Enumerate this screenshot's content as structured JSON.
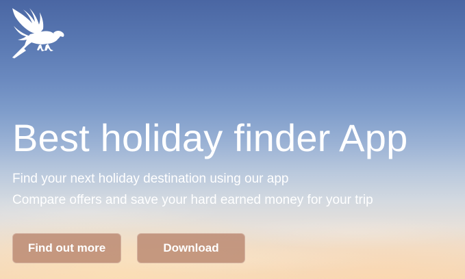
{
  "logo": {
    "icon": "eagle-icon"
  },
  "hero": {
    "title": "Best holiday finder App",
    "subtitle_line1": "Find your next holiday destination using our app",
    "subtitle_line2": "Compare offers and save your hard earned money for your trip"
  },
  "buttons": {
    "find_out_more": "Find out more",
    "download": "Download"
  },
  "colors": {
    "sky_top": "#4a66a3",
    "sky_bottom": "#f6d8b6",
    "button_bg": "#b98870",
    "text": "#ffffff"
  }
}
